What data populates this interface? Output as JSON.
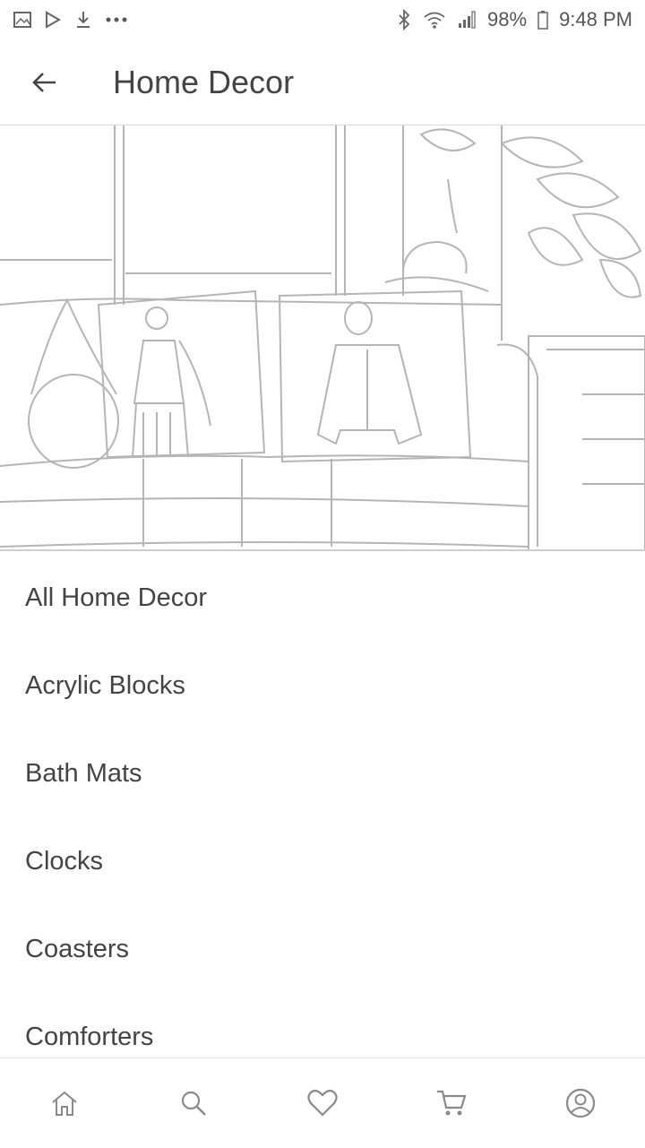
{
  "status_bar": {
    "battery": "98%",
    "time": "9:48 PM",
    "left_icons": [
      "image-icon",
      "play-store-icon",
      "download-icon",
      "more-dots-icon"
    ],
    "right_icons": [
      "bluetooth-icon",
      "wifi-icon",
      "signal-icon",
      "battery-icon"
    ]
  },
  "app_bar": {
    "back_icon": "arrow-left-icon",
    "title": "Home Decor"
  },
  "categories": [
    {
      "label": "All Home Decor"
    },
    {
      "label": "Acrylic Blocks"
    },
    {
      "label": "Bath Mats"
    },
    {
      "label": "Clocks"
    },
    {
      "label": "Coasters"
    },
    {
      "label": "Comforters"
    }
  ],
  "bottom_nav": [
    "home-icon",
    "search-icon",
    "heart-icon",
    "cart-icon",
    "account-icon"
  ]
}
